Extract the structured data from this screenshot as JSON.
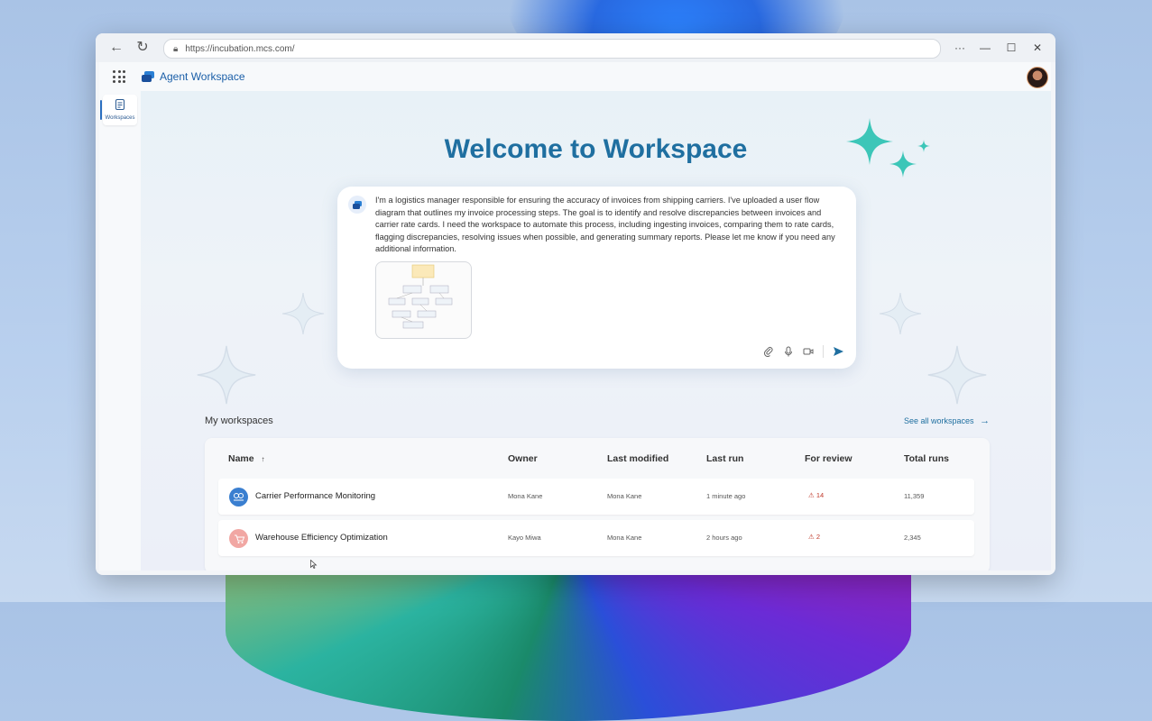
{
  "browser": {
    "url": "https://incubation.mcs.com/",
    "back_icon": "back-arrow-icon",
    "refresh_icon": "refresh-icon",
    "more_icon": "more-icon",
    "minimize_icon": "minimize-icon",
    "maximize_icon": "maximize-icon",
    "close_icon": "close-icon"
  },
  "app": {
    "title": "Agent Workspace",
    "sidebar": {
      "items": [
        {
          "label": "Workspaces",
          "icon": "workspace-icon",
          "active": true
        }
      ]
    }
  },
  "main": {
    "welcome_title": "Welcome to Workspace",
    "prompt": {
      "text": "I'm a logistics manager responsible for ensuring the accuracy of invoices from shipping carriers. I've uploaded a user flow diagram that outlines my invoice processing steps. The goal is to identify and resolve discrepancies between invoices and carrier rate cards. I need the workspace to automate this process, including ingesting invoices, comparing them to rate cards, flagging discrepancies, resolving issues when possible, and generating summary reports. Please let me know if you need any additional information.",
      "tools": [
        "attach-icon",
        "microphone-icon",
        "video-icon",
        "send-icon"
      ]
    },
    "workspaces": {
      "section_title": "My workspaces",
      "see_all": "See all workspaces",
      "columns": [
        "Name",
        "Owner",
        "Last modified",
        "Last run",
        "For review",
        "Total runs"
      ],
      "sort_indicator": "↑",
      "rows": [
        {
          "name": "Carrier Performance Monitoring",
          "owner": "Mona Kane",
          "last_modified": "Mona Kane",
          "last_run": "1 minute ago",
          "for_review": "14",
          "total_runs": "11,359",
          "icon_color": "#3a7fd0"
        },
        {
          "name": "Warehouse Efficiency Optimization",
          "owner": "Kayo Miwa",
          "last_modified": "Mona Kane",
          "last_run": "2 hours ago",
          "for_review": "2",
          "total_runs": "2,345",
          "icon_color": "#f1a7a3"
        }
      ]
    }
  },
  "colors": {
    "accent": "#1f6fa0",
    "alert": "#c0392b",
    "sparkle": "#3cc6b8"
  }
}
